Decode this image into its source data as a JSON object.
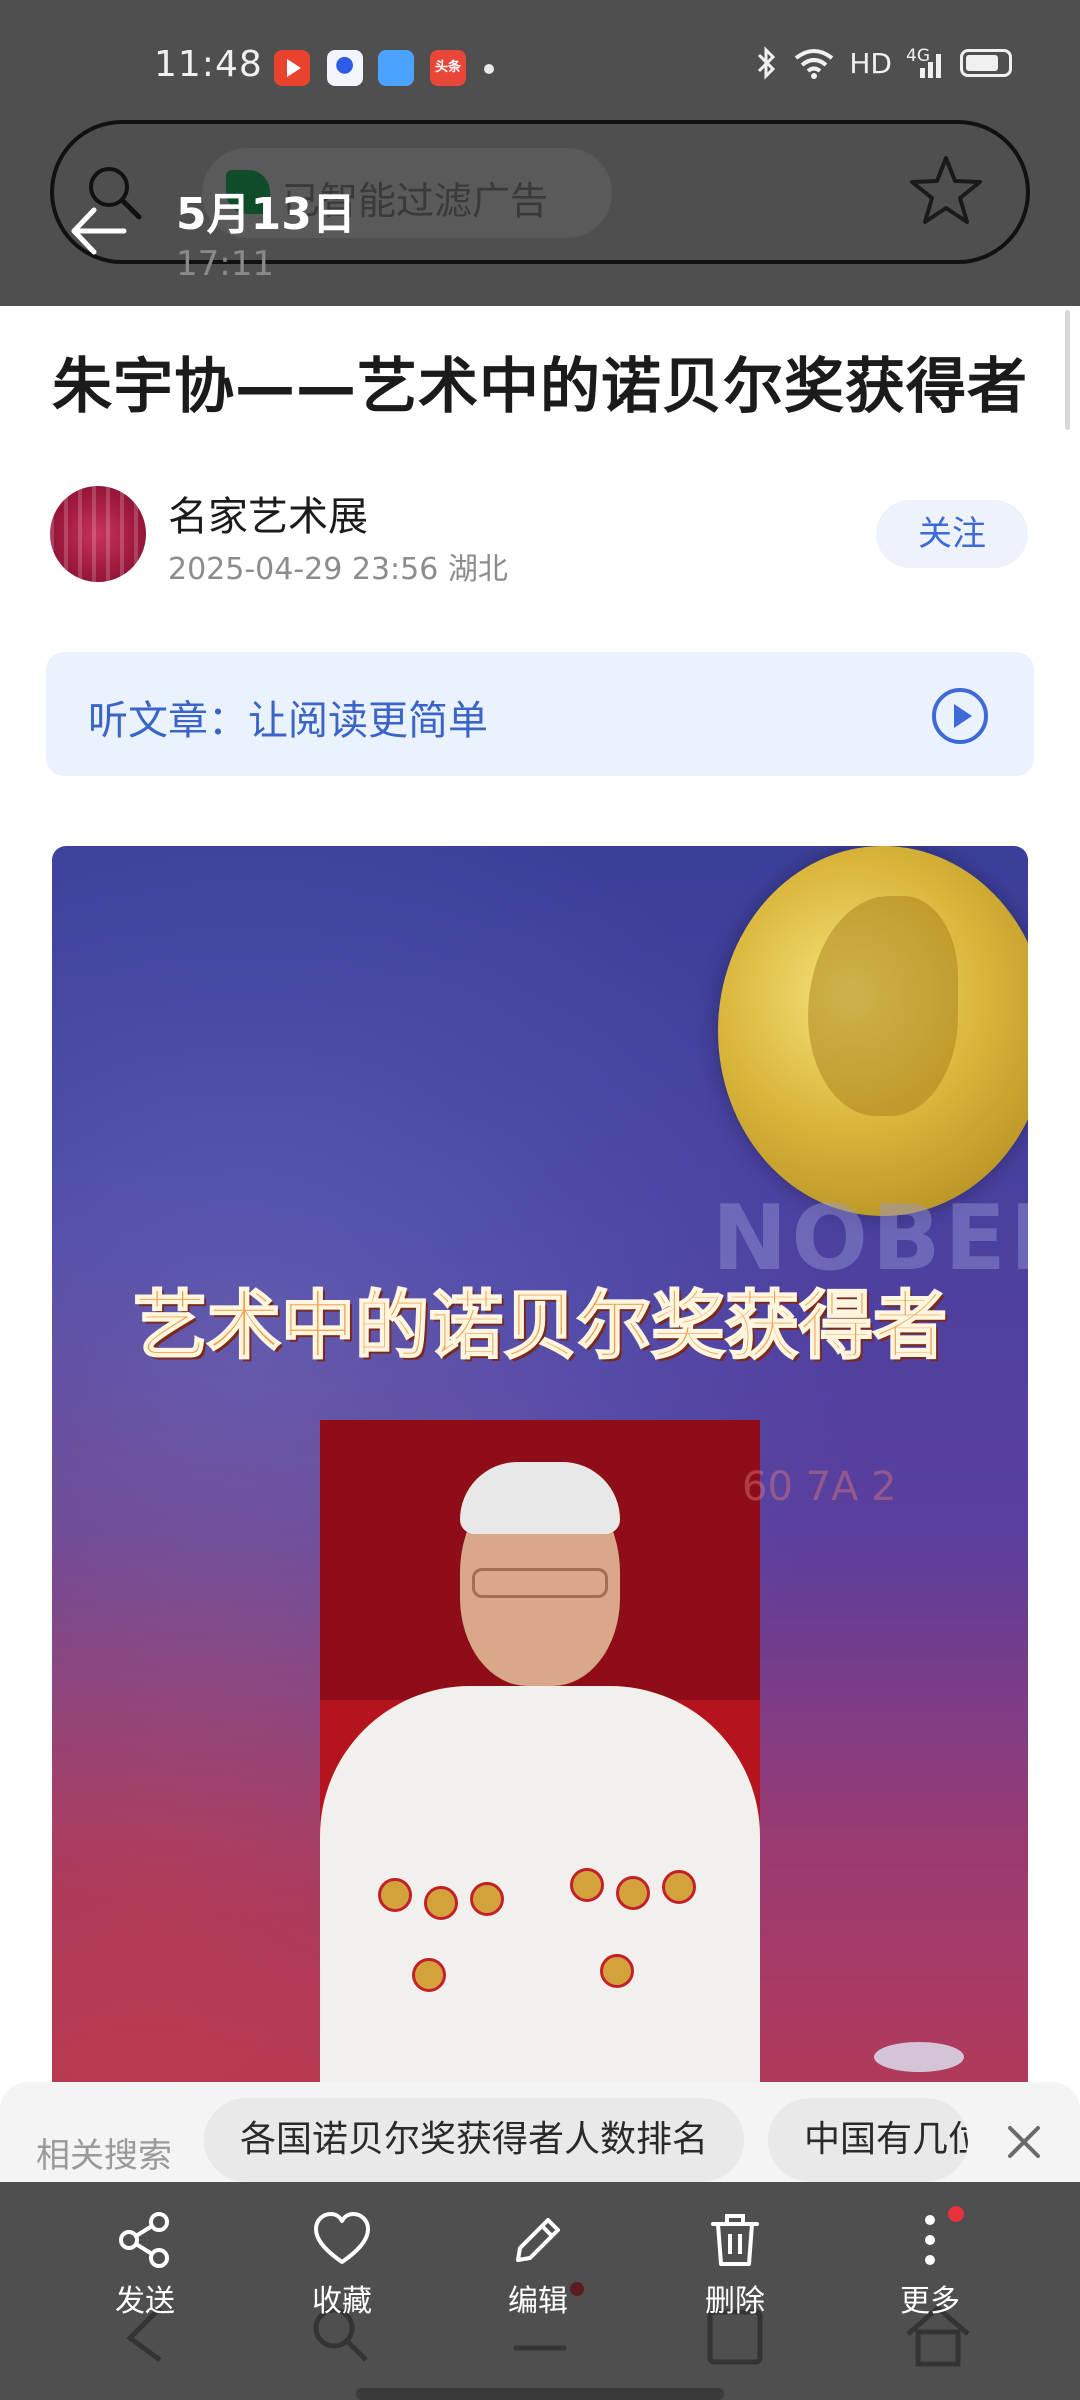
{
  "status_bar": {
    "time": "11:48",
    "network": "HD",
    "signal": "4G",
    "app_icons": [
      "video-app-icon",
      "baidu-app-icon",
      "feather-app-icon",
      "toutiao-app-icon"
    ],
    "toutiao_icon_text": "头条"
  },
  "toolbar": {
    "filter_text": "已智能过滤广告",
    "date": "5月13日",
    "time": "17:11"
  },
  "article": {
    "title": "朱宇协——艺术中的诺贝尔奖获得者",
    "author": "名家艺术展",
    "meta": "2025-04-29 23:56   湖北",
    "follow_label": "关注",
    "listen_label": "听文章：让阅读更简单"
  },
  "main_image": {
    "caption": "艺术中的诺贝尔奖获得者",
    "medal_text": "NOBEL",
    "backdrop_text": "60 7A 2"
  },
  "related": {
    "label": "相关搜索",
    "chips": [
      "各国诺贝尔奖获得者人数排名",
      "中国有几位"
    ]
  },
  "actions": [
    {
      "label": "发送",
      "icon": "share-icon"
    },
    {
      "label": "收藏",
      "icon": "heart-icon"
    },
    {
      "label": "编辑",
      "icon": "pencil-icon"
    },
    {
      "label": "删除",
      "icon": "trash-icon"
    },
    {
      "label": "更多",
      "icon": "more-vertical-icon"
    }
  ],
  "colors": {
    "accent": "#3d6ad6",
    "overlay": "#4f4f4f",
    "badge": "#e8313b"
  }
}
